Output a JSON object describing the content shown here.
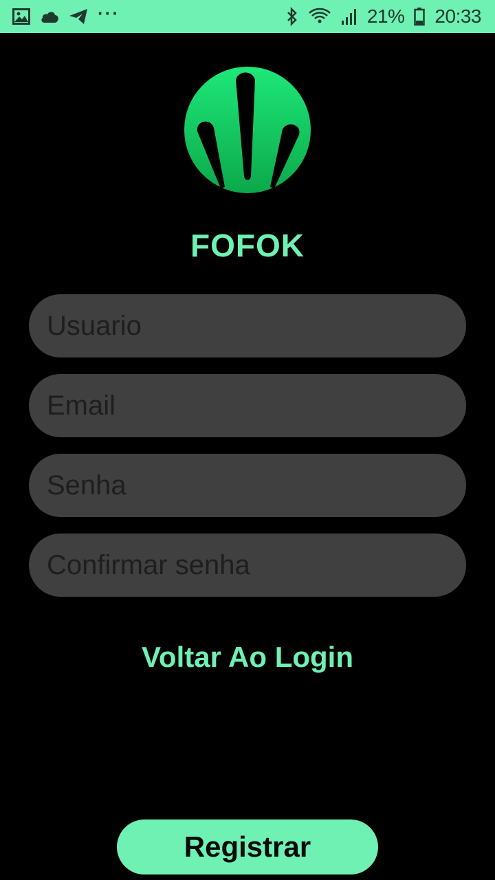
{
  "status_bar": {
    "battery_percent": "21%",
    "time": "20:33",
    "left_icons": [
      "image-icon",
      "cloud-icon",
      "telegram-icon",
      "more-dots-icon"
    ],
    "right_icons": [
      "bluetooth-icon",
      "wifi-icon",
      "signal-icon",
      "battery-icon"
    ]
  },
  "app": {
    "title": "FOFOK",
    "logo_icon": "fofok-logo-icon"
  },
  "form": {
    "username_placeholder": "Usuario",
    "email_placeholder": "Email",
    "password_placeholder": "Senha",
    "confirm_password_placeholder": "Confirmar senha"
  },
  "actions": {
    "back_to_login": "Voltar Ao Login",
    "register": "Registrar"
  },
  "colors": {
    "accent": "#6ff1b4",
    "background": "#000000",
    "field_bg": "#404040",
    "logo_green": "#16c95c"
  }
}
